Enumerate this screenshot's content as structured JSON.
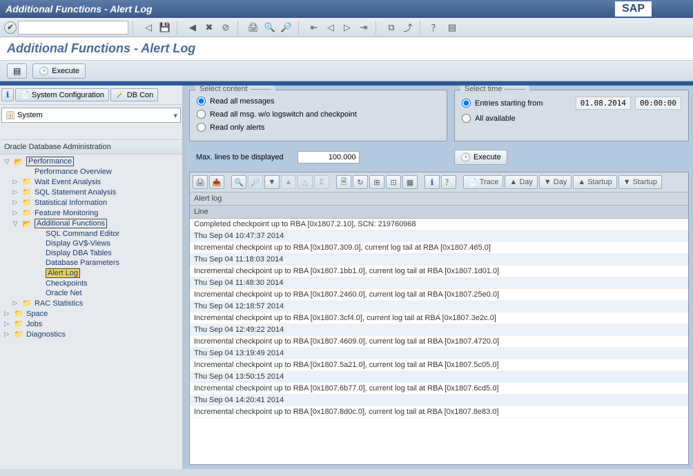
{
  "titlebar": {
    "title": "Additional Functions - Alert Log",
    "logo": "SAP"
  },
  "subheader": {
    "title": "Additional Functions - Alert Log"
  },
  "cmdbar": {
    "execute": "Execute"
  },
  "left": {
    "tabs": {
      "info": "ℹ",
      "syscfg": "System Configuration",
      "dbcon": "DB Con"
    },
    "dropdown": {
      "value": "System"
    },
    "tree_title": "Oracle Database Administration",
    "perf": "Performance",
    "perf_overview": "Performance Overview",
    "wait": "Wait Event Analysis",
    "sql": "SQL Statement Analysis",
    "stat": "Statistical Information",
    "feat": "Feature Monitoring",
    "addl": "Additional Functions",
    "sqlcmd": "SQL Command Editor",
    "gv": "Display GV$-Views",
    "dba": "Display DBA Tables",
    "dbparm": "Database Parameters",
    "alert": "Alert Log",
    "chk": "Checkpoints",
    "onet": "Oracle Net",
    "rac": "RAC Statistics",
    "space": "Space",
    "jobs": "Jobs",
    "diag": "Diagnostics"
  },
  "right": {
    "select_content": {
      "title": "Select content",
      "opt1": "Read all messages",
      "opt2": "Read all msg. w/o logswitch and checkpoint",
      "opt3": "Read only alerts"
    },
    "select_time": {
      "title": "Select time",
      "opt1": "Entries starting from",
      "opt2": "All available",
      "date": "01.08.2014",
      "time": "00:00:00"
    },
    "maxlines": {
      "label": "Max. lines to be displayed",
      "value": "100.000"
    },
    "execute": "Execute",
    "grid_toolbar": {
      "trace": "Trace",
      "day_up": "Day",
      "day_dn": "Day",
      "start_up": "Startup",
      "start_dn": "Startup"
    },
    "grid": {
      "title": "Alert log",
      "colhead": "Line",
      "rows": [
        "Completed checkpoint up to RBA [0x1807.2.10], SCN: 219760968",
        "Thu Sep 04 10:47:37 2014",
        "Incremental checkpoint up to RBA [0x1807.309.0], current log tail at RBA [0x1807.465.0]",
        "Thu Sep 04 11:18:03 2014",
        "Incremental checkpoint up to RBA [0x1807.1bb1.0], current log tail at RBA [0x1807.1d01.0]",
        "Thu Sep 04 11:48:30 2014",
        "Incremental checkpoint up to RBA [0x1807.2460.0], current log tail at RBA [0x1807.25e0.0]",
        "Thu Sep 04 12:18:57 2014",
        "Incremental checkpoint up to RBA [0x1807.3cf4.0], current log tail at RBA [0x1807.3e2c.0]",
        "Thu Sep 04 12:49:22 2014",
        "Incremental checkpoint up to RBA [0x1807.4609.0], current log tail at RBA [0x1807.4720.0]",
        "Thu Sep 04 13:19:49 2014",
        "Incremental checkpoint up to RBA [0x1807.5a21.0], current log tail at RBA [0x1807.5c05.0]",
        "Thu Sep 04 13:50:15 2014",
        "Incremental checkpoint up to RBA [0x1807.6b77.0], current log tail at RBA [0x1807.6cd5.0]",
        "Thu Sep 04 14:20:41 2014",
        "Incremental checkpoint up to RBA [0x1807.8d0c.0], current log tail at RBA [0x1807.8e83.0]"
      ]
    }
  }
}
